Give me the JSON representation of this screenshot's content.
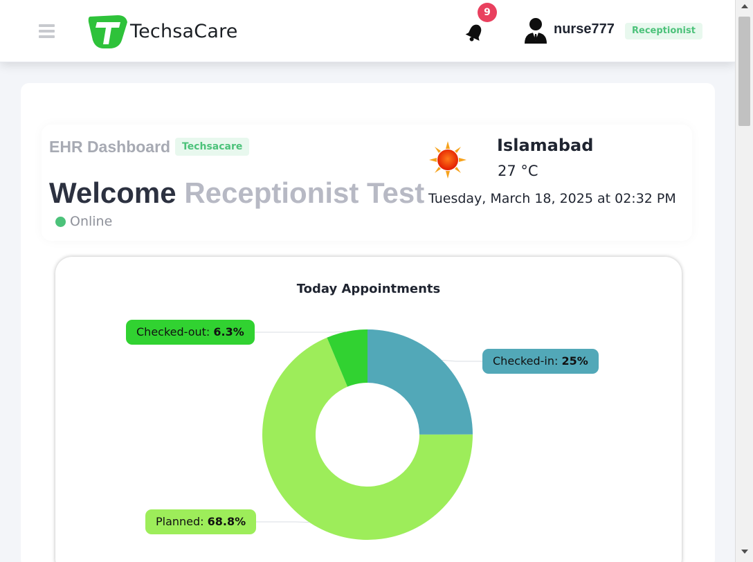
{
  "header": {
    "brand": "TechsaCare",
    "notification_count": "9",
    "username": "nurse777",
    "role": "Receptionist"
  },
  "dashboard": {
    "title": "EHR Dashboard",
    "org_chip": "Techsacare",
    "welcome_word": "Welcome",
    "user_display_name": "Receptionist Test",
    "status": "Online"
  },
  "weather": {
    "icon": "sun-icon",
    "city": "Islamabad",
    "temperature": "27 °C",
    "datetime": "Tuesday, March 18, 2025 at 02:32 PM"
  },
  "chart_data": {
    "type": "pie",
    "title": "Today Appointments",
    "donut": true,
    "slices": [
      {
        "label": "Checked-in",
        "value": 25,
        "display": "25%",
        "color": "#52a8b8"
      },
      {
        "label": "Planned",
        "value": 68.8,
        "display": "68.8%",
        "color": "#9ded5a"
      },
      {
        "label": "Checked-out",
        "value": 6.3,
        "display": "6.3%",
        "color": "#31d231"
      }
    ]
  },
  "colors": {
    "accent_green": "#4cc27a",
    "badge_red": "#e9405e"
  }
}
